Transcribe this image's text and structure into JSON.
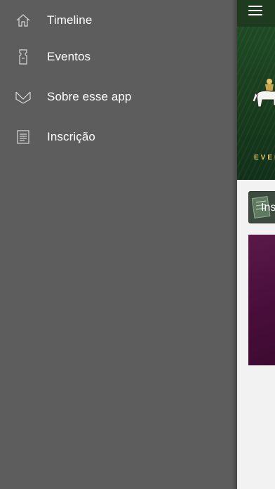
{
  "drawer": {
    "items": [
      {
        "label": "Timeline",
        "icon": "home-icon"
      },
      {
        "label": "Eventos",
        "icon": "ticket-icon"
      },
      {
        "label": "Sobre esse app",
        "icon": "envelope-icon"
      },
      {
        "label": "Inscrição",
        "icon": "document-icon"
      }
    ]
  },
  "main": {
    "menu_icon": "hamburger-icon",
    "banner_text": "EVEN",
    "tile_label": "Insc",
    "colors": {
      "topbar": "#1e3a1f",
      "banner": "#1f4a24",
      "card": "#4a0f3c",
      "drawer": "#5d5d5d"
    }
  }
}
